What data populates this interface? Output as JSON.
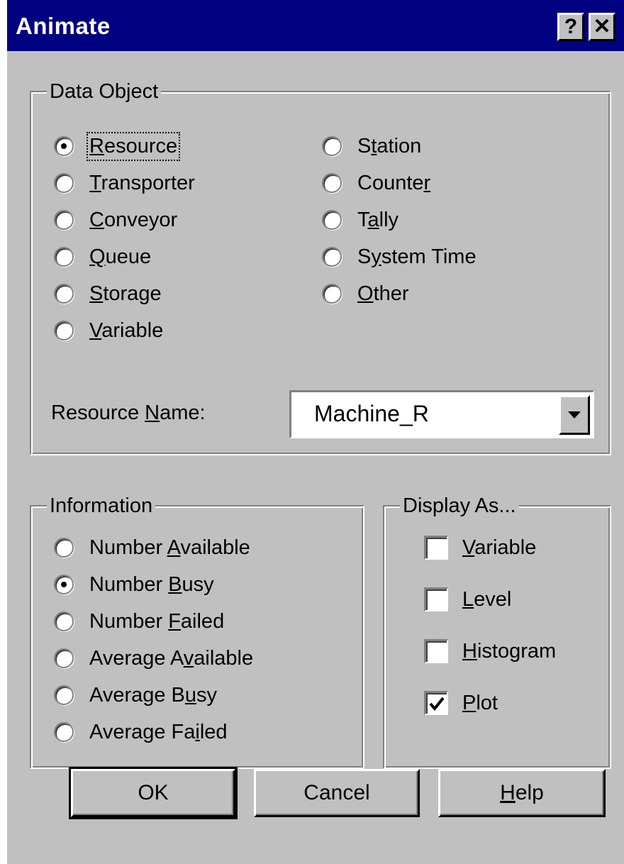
{
  "window": {
    "title": "Animate",
    "help_button": "?",
    "close_button": "✕"
  },
  "data_object": {
    "legend": "Data Object",
    "selected": "Resource",
    "options_left": [
      {
        "pre": "",
        "key": "R",
        "post": "esource",
        "checked": true
      },
      {
        "pre": "",
        "key": "T",
        "post": "ransporter",
        "checked": false
      },
      {
        "pre": "",
        "key": "C",
        "post": "onveyor",
        "checked": false
      },
      {
        "pre": "",
        "key": "Q",
        "post": "ueue",
        "checked": false
      },
      {
        "pre": "",
        "key": "S",
        "post": "torage",
        "checked": false
      },
      {
        "pre": "",
        "key": "V",
        "post": "ariable",
        "checked": false
      }
    ],
    "options_right": [
      {
        "pre": "S",
        "key": "t",
        "post": "ation",
        "checked": false
      },
      {
        "pre": "Counte",
        "key": "r",
        "post": "",
        "checked": false
      },
      {
        "pre": "T",
        "key": "a",
        "post": "lly",
        "checked": false
      },
      {
        "pre": "S",
        "key": "y",
        "post": "stem Time",
        "checked": false
      },
      {
        "pre": "",
        "key": "O",
        "post": "ther",
        "checked": false
      }
    ],
    "name_label_pre": "Resource ",
    "name_label_key": "N",
    "name_label_post": "ame:",
    "name_value": "Machine_R"
  },
  "information": {
    "legend": "Information",
    "options": [
      {
        "pre": "Number ",
        "key": "A",
        "post": "vailable",
        "checked": false
      },
      {
        "pre": "Number ",
        "key": "B",
        "post": "usy",
        "checked": true
      },
      {
        "pre": "Number ",
        "key": "F",
        "post": "ailed",
        "checked": false
      },
      {
        "pre": "Average A",
        "key": "v",
        "post": "ailable",
        "checked": false
      },
      {
        "pre": "Average B",
        "key": "u",
        "post": "sy",
        "checked": false
      },
      {
        "pre": "Average Fa",
        "key": "i",
        "post": "led",
        "checked": false
      }
    ]
  },
  "display_as": {
    "legend": "Display As...",
    "options": [
      {
        "pre": "",
        "key": "V",
        "post": "ariable",
        "checked": false
      },
      {
        "pre": "",
        "key": "L",
        "post": "evel",
        "checked": false
      },
      {
        "pre": "",
        "key": "H",
        "post": "istogram",
        "checked": false
      },
      {
        "pre": "",
        "key": "P",
        "post": "lot",
        "checked": true
      }
    ]
  },
  "buttons": {
    "ok": "OK",
    "cancel": "Cancel",
    "help_key": "H",
    "help_post": "elp"
  }
}
